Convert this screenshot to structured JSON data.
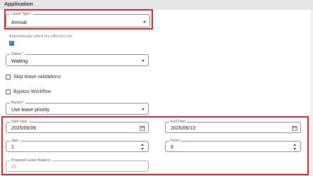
{
  "header": {
    "title": "Application"
  },
  "leave_type": {
    "label": "Leave Type",
    "value": "Annual"
  },
  "auto_effective_run": {
    "label": "Automatically select the effective run",
    "checked": true
  },
  "status": {
    "label": "Status",
    "value": "Waiting"
  },
  "skip_validations": {
    "label": "Skip leave validations",
    "checked": false
  },
  "bypass_workflow": {
    "label": "Bypass Workflow",
    "checked": false
  },
  "bucket": {
    "label": "Bucket",
    "value": "Use leave priority"
  },
  "start_date": {
    "label": "Start Date",
    "value": "2025/06/09"
  },
  "end_date": {
    "label": "End Date",
    "value": "2025/06/13"
  },
  "days": {
    "label": "days",
    "value": "1"
  },
  "hours": {
    "label": "Hours",
    "value": "8"
  },
  "projected_balance": {
    "label": "Projected Leave Balance",
    "value": "21"
  },
  "colors": {
    "highlight": "#d0202a",
    "checkbox": "#3f6fb5",
    "required": "#c41e3a",
    "header_bg": "#e6e6e6"
  }
}
